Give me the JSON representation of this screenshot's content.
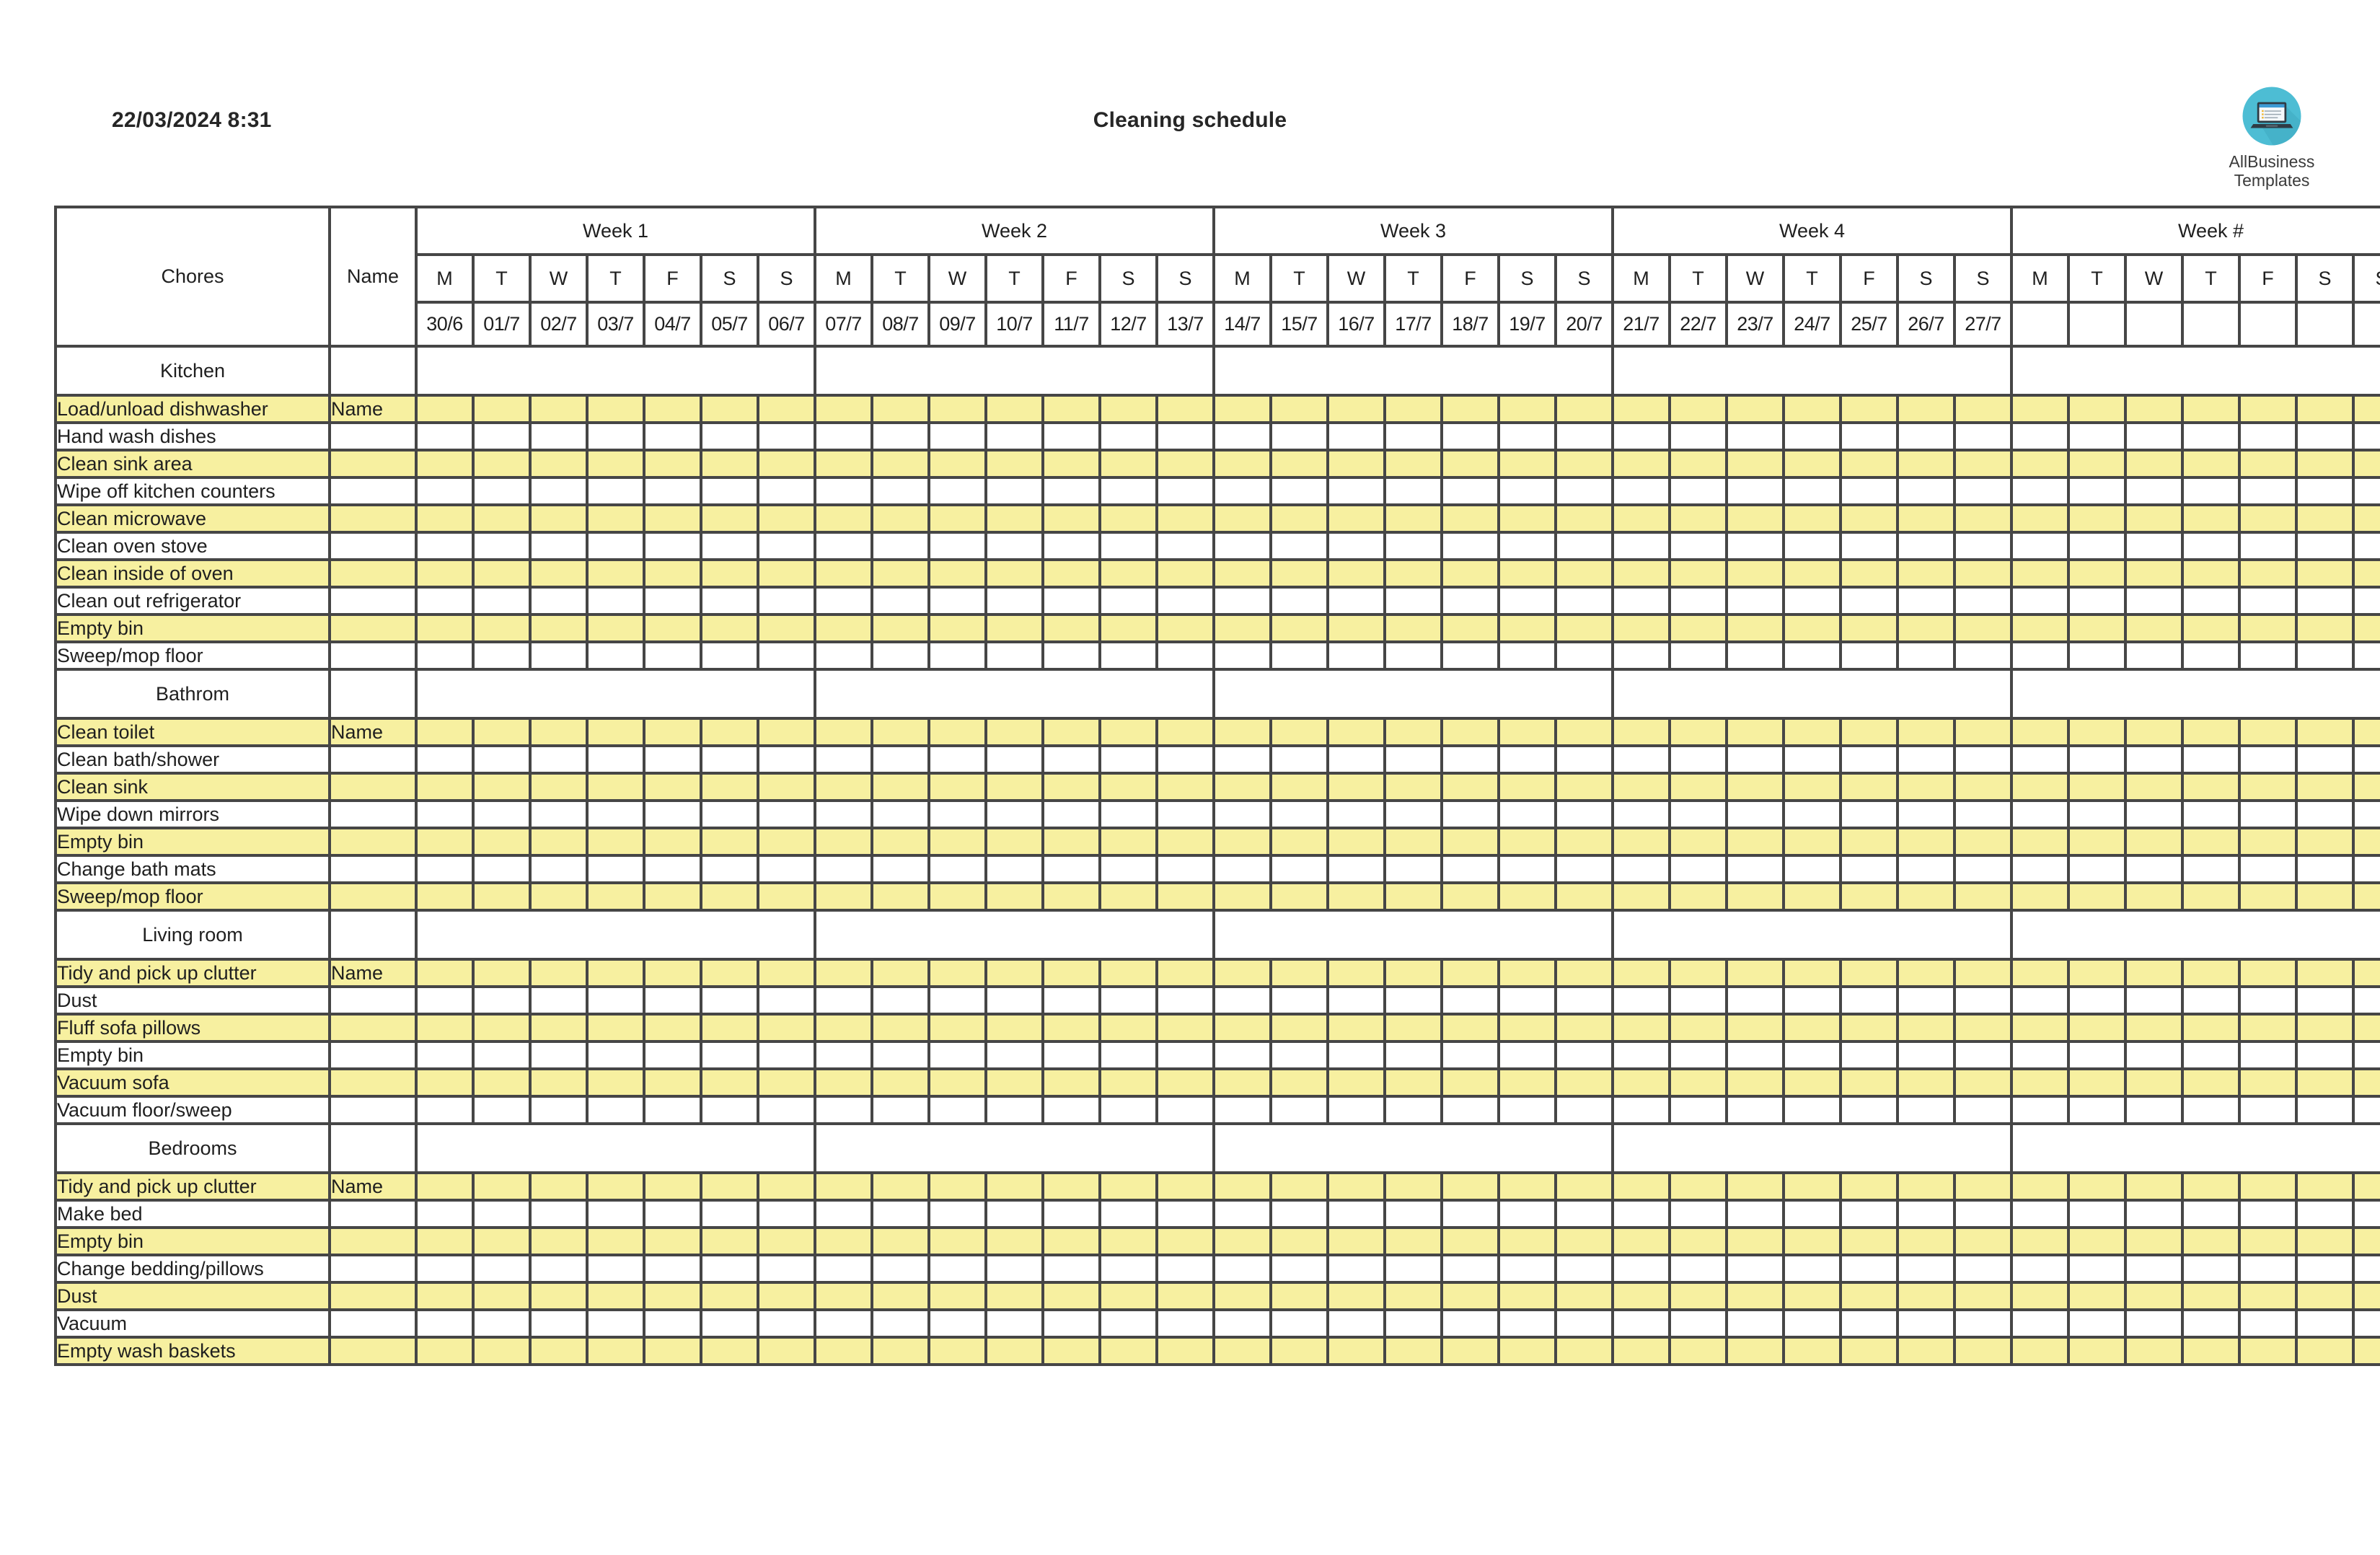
{
  "header": {
    "datetime": "22/03/2024 8:31",
    "title": "Cleaning schedule"
  },
  "logo": {
    "icon": "laptop-icon",
    "line1": "AllBusiness",
    "line2": "Templates",
    "circle_color": "#4DBDD4",
    "laptop_color": "#2F3B44"
  },
  "table": {
    "col_chores_label": "Chores",
    "col_name_label": "Name",
    "name_placeholder": "Name",
    "day_labels": [
      "M",
      "T",
      "W",
      "T",
      "F",
      "S",
      "S"
    ],
    "weeks": [
      {
        "label": "Week 1",
        "dates": [
          "30/6",
          "01/7",
          "02/7",
          "03/7",
          "04/7",
          "05/7",
          "06/7"
        ]
      },
      {
        "label": "Week 2",
        "dates": [
          "07/7",
          "08/7",
          "09/7",
          "10/7",
          "11/7",
          "12/7",
          "13/7"
        ]
      },
      {
        "label": "Week 3",
        "dates": [
          "14/7",
          "15/7",
          "16/7",
          "17/7",
          "18/7",
          "19/7",
          "20/7"
        ]
      },
      {
        "label": "Week 4",
        "dates": [
          "21/7",
          "22/7",
          "23/7",
          "24/7",
          "25/7",
          "26/7",
          "27/7"
        ]
      },
      {
        "label": "Week #",
        "dates": [
          "",
          "",
          "",
          "",
          "",
          "",
          ""
        ]
      }
    ],
    "sections": [
      {
        "title": "Kitchen",
        "chores": [
          "Load/unload dishwasher",
          "Hand wash dishes",
          "Clean sink area",
          "Wipe off kitchen counters",
          "Clean microwave",
          "Clean oven stove",
          "Clean inside of oven",
          "Clean out refrigerator",
          "Empty bin",
          "Sweep/mop floor"
        ]
      },
      {
        "title": "Bathrom",
        "chores": [
          "Clean toilet",
          "Clean bath/shower",
          "Clean sink",
          "Wipe down mirrors",
          "Empty bin",
          "Change bath mats",
          "Sweep/mop floor"
        ]
      },
      {
        "title": "Living room",
        "chores": [
          "Tidy and pick up clutter",
          "Dust",
          "Fluff sofa pillows",
          "Empty bin",
          "Vacuum sofa",
          "Vacuum floor/sweep"
        ]
      },
      {
        "title": "Bedrooms",
        "chores": [
          "Tidy and pick up clutter",
          "Make bed",
          "Empty bin",
          "Change bedding/pillows",
          "Dust",
          "Vacuum",
          "Empty wash baskets"
        ]
      }
    ]
  },
  "colors": {
    "stripe_yellow": "#F7F0A0",
    "grid_border": "#464646",
    "text": "#1f1f1f"
  }
}
